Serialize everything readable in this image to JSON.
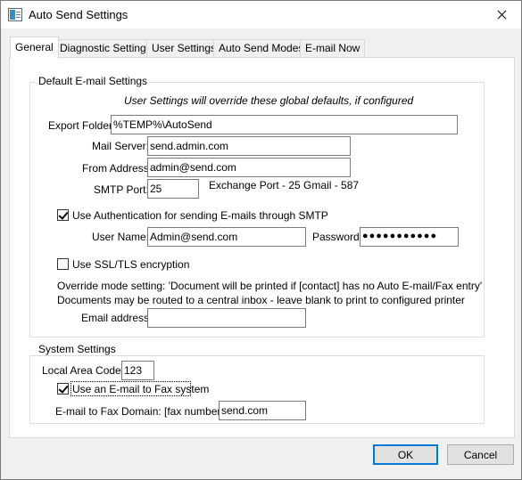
{
  "window": {
    "title": "Auto Send Settings"
  },
  "tabs": [
    "General",
    "Diagnostic Settings",
    "User Settings",
    "Auto Send Modes",
    "E-mail Now"
  ],
  "default_email": {
    "group_label": "Default E-mail Settings",
    "note": "User Settings will override these global defaults, if configured",
    "export_folder_label": "Export Folder:",
    "export_folder_value": "%TEMP%\\AutoSend",
    "mail_server_label": "Mail Server:",
    "mail_server_value": "send.admin.com",
    "from_address_label": "From Address:",
    "from_address_value": "admin@send.com",
    "smtp_port_label": "SMTP Port:",
    "smtp_port_value": "25",
    "port_hint": "Exchange Port - 25  Gmail - 587",
    "use_auth_label": "Use Authentication for sending E-mails through SMTP",
    "use_auth_checked": true,
    "user_name_label": "User Name:",
    "user_name_value": "Admin@send.com",
    "password_label": "Password:",
    "password_value": "●●●●●●●●●●●",
    "ssl_label": "Use SSL/TLS encryption",
    "ssl_checked": false,
    "override_line1": "Override mode setting: 'Document will be printed if [contact] has no Auto E-mail/Fax entry'",
    "override_line2": "Documents may be routed to a central inbox - leave blank to print to configured printer",
    "email_address_label": "Email address:",
    "email_address_value": ""
  },
  "system": {
    "group_label": "System Settings",
    "area_code_label": "Local Area Code:",
    "area_code_value": "123",
    "email_fax_label": "Use an E-mail to Fax system",
    "email_fax_checked": true,
    "fax_domain_label": "E-mail to Fax Domain:",
    "fax_prefix": "[fax number]@",
    "fax_domain_value": "send.com"
  },
  "buttons": {
    "ok": "OK",
    "cancel": "Cancel"
  }
}
